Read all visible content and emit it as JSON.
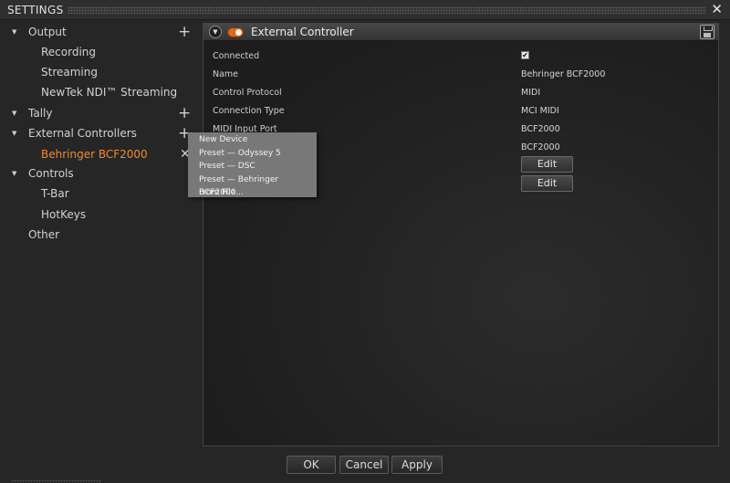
{
  "window": {
    "title": "SETTINGS",
    "close_glyph": "✕"
  },
  "nav": {
    "items": [
      {
        "label": "Output",
        "arrow": "▼",
        "plus": "+"
      },
      {
        "label": "Recording"
      },
      {
        "label": "Streaming"
      },
      {
        "label": "NewTek NDI™ Streaming"
      },
      {
        "label": "Tally",
        "arrow": "▼",
        "plus": "+"
      },
      {
        "label": "External Controllers",
        "arrow": "▼",
        "plus": "+"
      },
      {
        "label": "Behringer BCF2000",
        "close": "✕"
      },
      {
        "label": "Controls",
        "arrow": "▼"
      },
      {
        "label": "T-Bar"
      },
      {
        "label": "HotKeys"
      },
      {
        "label": "Other"
      }
    ],
    "selected_color": "#f08a2a"
  },
  "panel": {
    "title": "External Controller",
    "chevron_glyph": "▼",
    "connected_label": "Connected",
    "connected_checked": true,
    "check_glyph": "✔",
    "rows": [
      {
        "label": "Name",
        "value": "Behringer BCF2000"
      },
      {
        "label": "Control Protocol",
        "value": "MIDI"
      },
      {
        "label": "Connection Type",
        "value": "MCI MIDI"
      },
      {
        "label": "MIDI Input Port",
        "value": "BCF2000"
      },
      {
        "label": "",
        "value": "BCF2000"
      }
    ],
    "edit_label": "Edit"
  },
  "menu": {
    "items": [
      "New Device",
      "Preset — Odyssey 5",
      "Preset — DSC",
      "Preset — Behringer BCF2000",
      "From File..."
    ]
  },
  "footer": {
    "ok": "OK",
    "cancel": "Cancel",
    "apply": "Apply"
  },
  "icons": {
    "expand": "triangle-down-icon",
    "add": "plus-icon",
    "remove": "close-icon",
    "save": "floppy-disk-icon",
    "toggle": "toggle-switch-icon"
  }
}
